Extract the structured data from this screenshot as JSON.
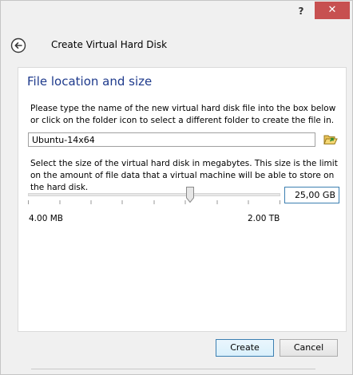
{
  "titlebar": {
    "help_label": "?",
    "close_label": "✕"
  },
  "header": {
    "title": "Create Virtual Hard Disk"
  },
  "section": {
    "title": "File location and size",
    "location_description": "Please type the name of the new virtual hard disk file into the box below or click on the folder icon to select a different folder to create the file in.",
    "file_name_value": "Ubuntu-14x64",
    "size_description": "Select the size of the virtual hard disk in megabytes. This size is the limit on the amount of file data that a virtual machine will be able to store on the hard disk.",
    "size_value": "25,00 GB",
    "slider_min_label": "4.00 MB",
    "slider_max_label": "2.00 TB"
  },
  "buttons": {
    "create_label": "Create",
    "cancel_label": "Cancel"
  },
  "colors": {
    "section_title": "#1e3a8c",
    "close_button": "#c75050",
    "focus_border": "#3c7fb1"
  },
  "icons": {
    "back": "back-arrow-icon",
    "folder": "folder-icon",
    "help": "help-icon",
    "close": "close-icon"
  }
}
